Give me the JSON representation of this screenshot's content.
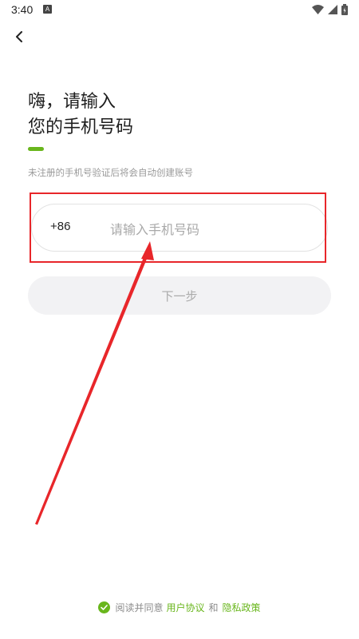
{
  "status_bar": {
    "time": "3:40",
    "notification_icon": "A"
  },
  "header": {
    "back_icon": "chevron-left-icon"
  },
  "title": {
    "line1": "嗨，请输入",
    "line2": "您的手机号码"
  },
  "hint": "未注册的手机号验证后将会自动创建账号",
  "phone_input": {
    "country_code": "+86",
    "placeholder": "请输入手机号码",
    "value": ""
  },
  "next_button": {
    "label": "下一步"
  },
  "agreement": {
    "prefix": "阅读并同意",
    "user_agreement": "用户协议",
    "and": "和",
    "privacy_policy": "隐私政策"
  },
  "colors": {
    "accent": "#69b61c",
    "annotation": "#e8262a"
  }
}
